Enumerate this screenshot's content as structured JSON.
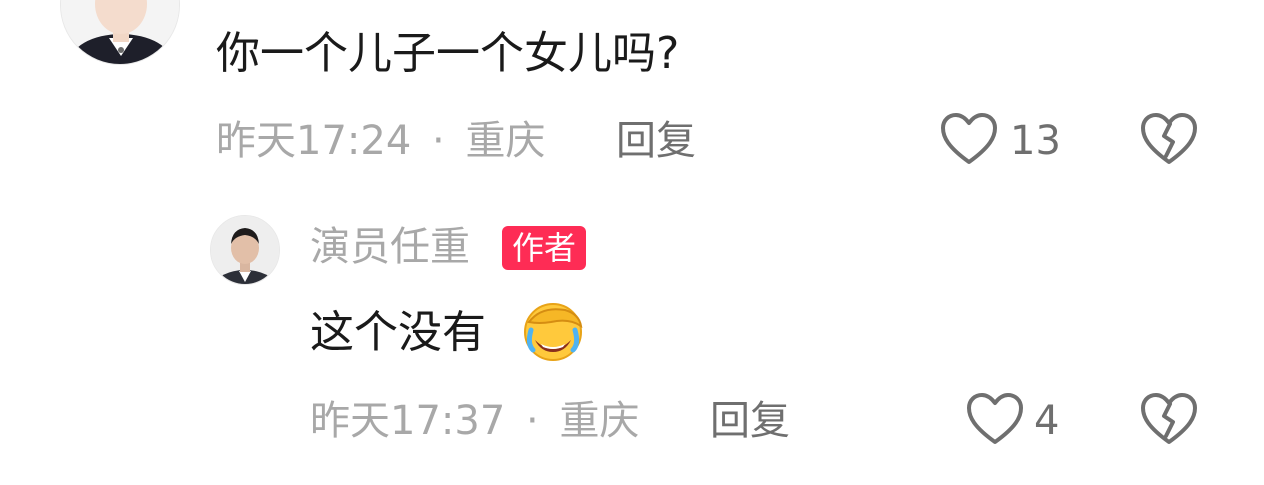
{
  "comments": [
    {
      "text": "你一个儿子一个女儿吗?",
      "time": "昨天17:24",
      "location": "重庆",
      "separator": "·",
      "reply_label": "回复",
      "like_count": "13"
    },
    {
      "author": "演员任重",
      "author_badge": "作者",
      "text": "这个没有",
      "time": "昨天17:37",
      "location": "重庆",
      "separator": "·",
      "reply_label": "回复",
      "like_count": "4"
    }
  ],
  "icons": {
    "like": "heart-outline-icon",
    "dislike": "broken-heart-icon",
    "emoji": "face-palm-crying-emoji"
  },
  "colors": {
    "badge": "#fe2c55",
    "meta": "#a8a8a8",
    "text": "#1a1a1a"
  }
}
